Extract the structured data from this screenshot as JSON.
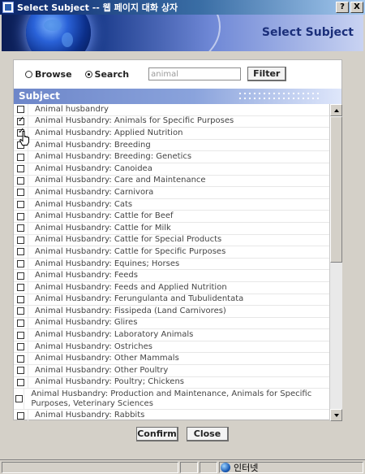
{
  "window": {
    "title": "Select Subject -- 웹 페이지 대화 상자",
    "help_btn": "?",
    "close_btn": "X"
  },
  "banner": {
    "title": "Select Subject"
  },
  "search": {
    "mode_browse_label": "Browse",
    "mode_search_label": "Search",
    "selected_mode": "Search",
    "query_value": "animal",
    "filter_label": "Filter"
  },
  "subject_header": "Subject",
  "subjects": [
    {
      "label": "Animal husbandry",
      "checked": false
    },
    {
      "label": "Animal Husbandry: Animals for Specific Purposes",
      "checked": true
    },
    {
      "label": "Animal Husbandry: Applied Nutrition",
      "checked": true
    },
    {
      "label": "Animal Husbandry: Breeding",
      "checked": false
    },
    {
      "label": "Animal Husbandry: Breeding: Genetics",
      "checked": false
    },
    {
      "label": "Animal Husbandry: Canoidea",
      "checked": false
    },
    {
      "label": "Animal Husbandry: Care and Maintenance",
      "checked": false
    },
    {
      "label": "Animal Husbandry: Carnivora",
      "checked": false
    },
    {
      "label": "Animal Husbandry: Cats",
      "checked": false
    },
    {
      "label": "Animal Husbandry: Cattle for Beef",
      "checked": false
    },
    {
      "label": "Animal Husbandry: Cattle for Milk",
      "checked": false
    },
    {
      "label": "Animal Husbandry: Cattle for Special Products",
      "checked": false
    },
    {
      "label": "Animal Husbandry: Cattle for Specific Purposes",
      "checked": false
    },
    {
      "label": "Animal Husbandry: Equines; Horses",
      "checked": false
    },
    {
      "label": "Animal Husbandry: Feeds",
      "checked": false
    },
    {
      "label": "Animal Husbandry: Feeds and Applied Nutrition",
      "checked": false
    },
    {
      "label": "Animal Husbandry: Ferungulanta and Tubulidentata",
      "checked": false
    },
    {
      "label": "Animal Husbandry: Fissipeda (Land Carnivores)",
      "checked": false
    },
    {
      "label": "Animal Husbandry: Glires",
      "checked": false
    },
    {
      "label": "Animal Husbandry: Laboratory Animals",
      "checked": false
    },
    {
      "label": "Animal Husbandry: Ostriches",
      "checked": false
    },
    {
      "label": "Animal Husbandry: Other Mammals",
      "checked": false
    },
    {
      "label": "Animal Husbandry: Other Poultry",
      "checked": false
    },
    {
      "label": "Animal Husbandry: Poultry; Chickens",
      "checked": false
    },
    {
      "label": "Animal Husbandry: Production and Maintenance, Animals for Specific Purposes, Veterinary Sciences",
      "checked": false,
      "tall": true
    },
    {
      "label": "Animal Husbandry: Rabbits",
      "checked": false
    }
  ],
  "buttons": {
    "confirm": "Confirm",
    "close": "Close"
  },
  "status": {
    "zone_label": "인터넷",
    "zone_icon": "globe-icon"
  }
}
